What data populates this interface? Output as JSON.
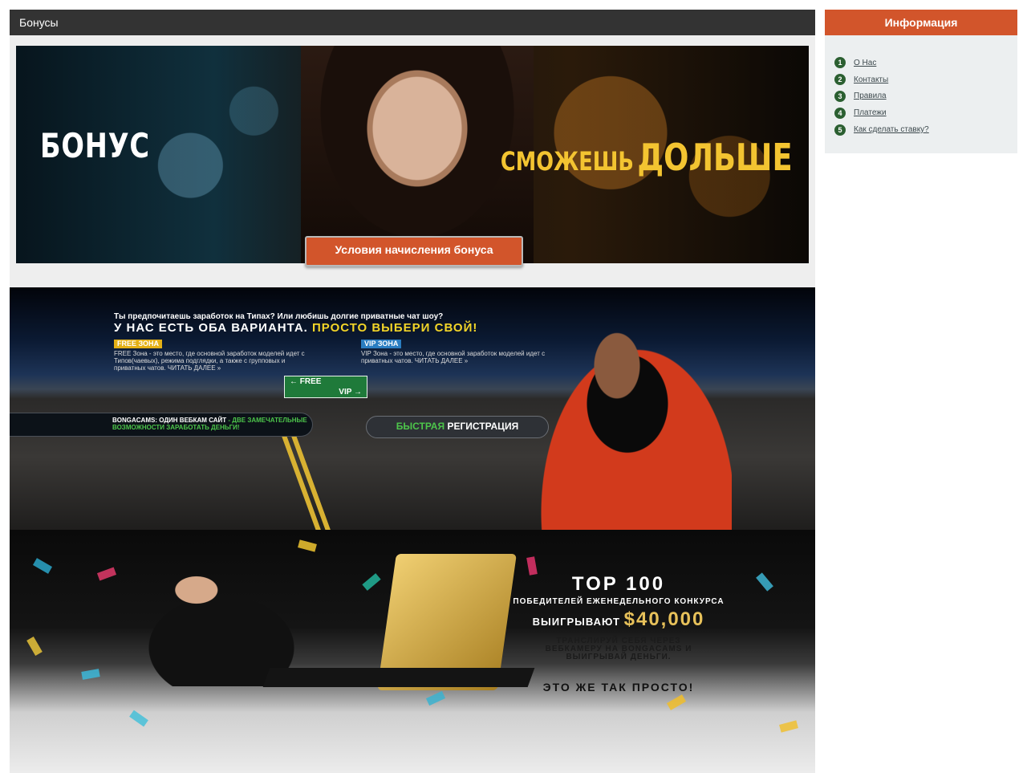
{
  "main": {
    "section_title": "Бонусы",
    "bonus_banner": {
      "word": "БОНУС",
      "slogan_small": "СМОЖЕШЬ",
      "slogan_big": "ДОЛЬШЕ",
      "terms_button": "Условия начисления бонуса"
    },
    "road_banner": {
      "question": "Ты предпочитаешь заработок на Типах? Или любишь долгие приватные чат шоу?",
      "headline": "У НАС ЕСТЬ ОБА ВАРИАНТА.",
      "headline_highlight": "ПРОСТО ВЫБЕРИ СВОЙ!",
      "free_tag": "FREE ЗОНА",
      "free_text": "FREE Зона - это место, где основной заработок моделей идет с Типов(чаевых), режима подглядки, а также с групповых и приватных чатов. ЧИТАТЬ ДАЛЕЕ »",
      "vip_tag": "VIP ЗОНА",
      "vip_text": "VIP Зона - это место, где основной заработок моделей идет с приватных чатов. ЧИТАТЬ ДАЛЕЕ »",
      "sign_free": "← FREE",
      "sign_vip": "VIP →",
      "left_pill": "BONGACAMS: ОДИН ВЕБКАМ САЙТ",
      "left_pill_green": "- ДВЕ ЗАМЕЧАТЕЛЬНЫЕ ВОЗМОЖНОСТИ ЗАРАБОТАТЬ ДЕНЬГИ!",
      "reg_green": "БЫСТРАЯ",
      "reg_white": "РЕГИСТРАЦИЯ"
    },
    "laptop_banner": {
      "title": "TOP 100",
      "subtitle": "ПОБЕДИТЕЛЕЙ ЕЖЕНЕДЕЛЬНОГО КОНКУРСА",
      "win_label": "ВЫИГРЫВАЮТ",
      "prize": "$40,000",
      "stream": "ТРАНСЛИРУЙ СЕБЯ ЧЕРЕЗ\nВЕБКАМЕРУ НА BONGACAMS И\nВЫИГРЫВАЙ ДЕНЬГИ.",
      "easy": "ЭТО ЖЕ ТАК ПРОСТО!"
    }
  },
  "sidebar": {
    "title": "Информация",
    "items": [
      {
        "num": "1",
        "label": "О Нас"
      },
      {
        "num": "2",
        "label": "Контакты"
      },
      {
        "num": "3",
        "label": "Правила"
      },
      {
        "num": "4",
        "label": "Платежи"
      },
      {
        "num": "5",
        "label": "Как сделать ставку?"
      }
    ]
  },
  "colors": {
    "accent": "#d2552b",
    "header_dark": "#333333",
    "number_badge": "#2b5f31",
    "highlight_yellow": "#f3d528"
  }
}
